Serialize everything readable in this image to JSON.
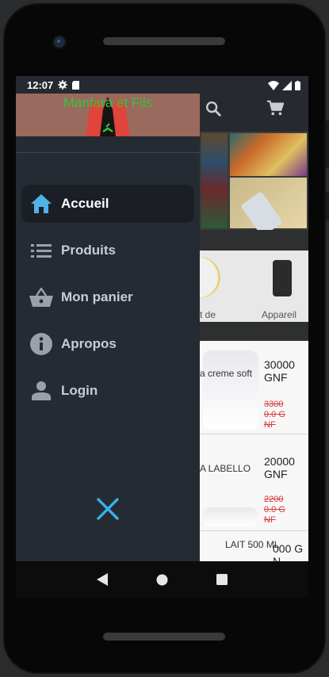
{
  "status_bar": {
    "time": "12:07"
  },
  "drawer": {
    "header_title": "Manfara et Fils",
    "menu": [
      {
        "label": "Accueil",
        "icon": "home-icon",
        "active": true
      },
      {
        "label": "Produits",
        "icon": "list-icon",
        "active": false
      },
      {
        "label": "Mon panier",
        "icon": "basket-icon",
        "active": false
      },
      {
        "label": "Apropos",
        "icon": "info-icon",
        "active": false
      },
      {
        "label": "Login",
        "icon": "person-icon",
        "active": false
      }
    ],
    "close_icon": "close-icon"
  },
  "background_app": {
    "actions": [
      "search-icon",
      "cart-icon"
    ],
    "categories": [
      {
        "label": "t de"
      },
      {
        "label": "Appareil"
      }
    ],
    "products": [
      {
        "name": "a creme soft",
        "price": "30000 GNF",
        "old_price": "33000.0 GNF"
      },
      {
        "name": "A  LABELLO",
        "price": "20000 GNF",
        "old_price": "22000.0 GNF"
      },
      {
        "name": "LAIT 500 ML",
        "price": "000 GN",
        "old_price": ""
      }
    ]
  },
  "colors": {
    "drawer_bg": "#252b33",
    "active_item_bg": "#1b1f25",
    "accent": "#3ab0e6",
    "header_title": "#3ac23a",
    "old_price": "#d73b3b"
  },
  "navbar": [
    "back-icon",
    "home-circle-icon",
    "recents-icon"
  ]
}
